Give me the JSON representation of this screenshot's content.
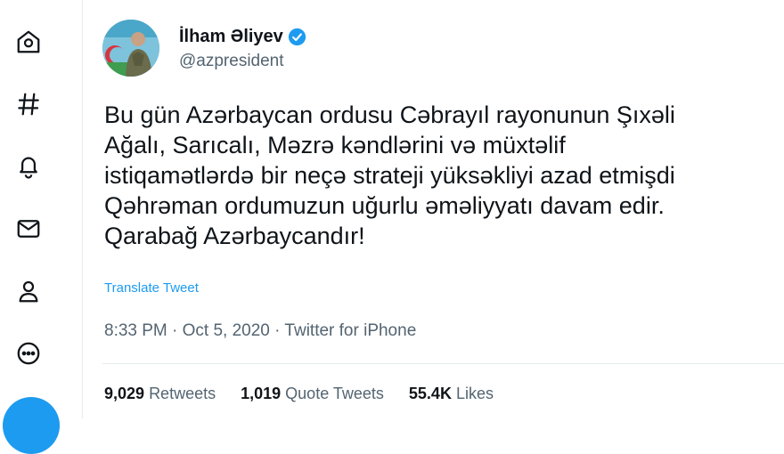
{
  "nav": {
    "icons": [
      "home-icon",
      "explore-hashtag-icon",
      "notifications-bell-icon",
      "messages-mail-icon",
      "profile-user-icon",
      "more-ellipsis-icon"
    ]
  },
  "tweet": {
    "author_name": "İlham Əliyev",
    "author_handle": "@azpresident",
    "text_lines": [
      "Bu gün Azərbaycan ordusu Cəbrayıl rayonunun Şıxəli",
      "Ağalı, Sarıcalı, Məzrə kəndlərini və müxtəlif",
      "istiqamətlərdə bir neçə strateji yüksəkliyi azad etmişdi",
      "Qəhrəman ordumuzun uğurlu əməliyyatı davam edir.",
      "Qarabağ Azərbaycandır!"
    ],
    "translate_label": "Translate Tweet",
    "timestamp": "8:33 PM · Oct 5, 2020 · Twitter for iPhone",
    "stats": {
      "retweets_count": "9,029",
      "retweets_label": "Retweets",
      "quotes_count": "1,019",
      "quotes_label": "Quote Tweets",
      "likes_count": "55.4K",
      "likes_label": "Likes"
    }
  },
  "colors": {
    "accent": "#1d9bf0",
    "secondary_text": "#536471",
    "divider": "#e6ecf0"
  }
}
